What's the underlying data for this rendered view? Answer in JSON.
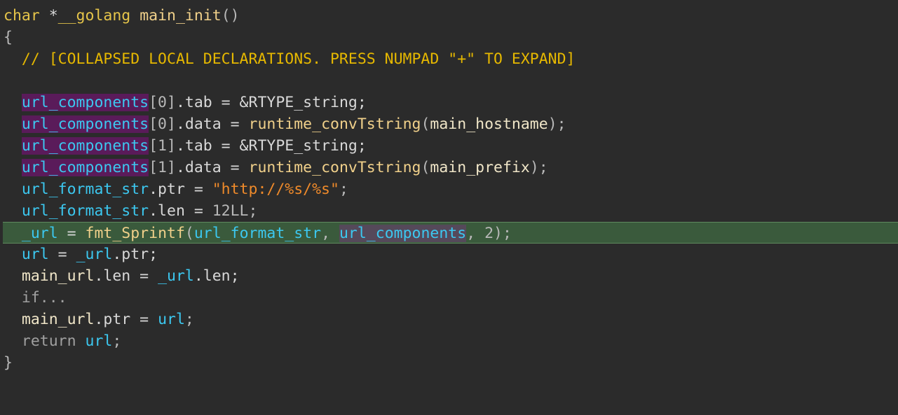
{
  "editor": {
    "lines": [
      {
        "id": "l0",
        "parts": [
          {
            "t": "char",
            "c": "tok-kw"
          },
          {
            "t": " *",
            "c": "tok-txt"
          },
          {
            "t": "__golang",
            "c": "tok-kw"
          },
          {
            "t": " ",
            "c": "tok-txt"
          },
          {
            "t": "main_init",
            "c": "tok-fn"
          },
          {
            "t": "()",
            "c": "tok-pun"
          }
        ]
      },
      {
        "id": "l1",
        "parts": [
          {
            "t": "{",
            "c": "tok-pun"
          }
        ]
      },
      {
        "id": "l2",
        "parts": [
          {
            "t": "  // [COLLAPSED LOCAL DECLARATIONS. PRESS NUMPAD \"+\" TO EXPAND]",
            "c": "tok-cm"
          }
        ]
      },
      {
        "id": "l3",
        "parts": []
      },
      {
        "id": "l4",
        "parts": [
          {
            "t": "  ",
            "c": "tok-txt"
          },
          {
            "t": "url_components",
            "c": "tok-var",
            "sel": "sel-purple"
          },
          {
            "t": "[0]",
            "c": "tok-pun"
          },
          {
            "t": ".tab = &RTYPE_string;",
            "c": "tok-txt"
          }
        ]
      },
      {
        "id": "l5",
        "parts": [
          {
            "t": "  ",
            "c": "tok-txt"
          },
          {
            "t": "url_components",
            "c": "tok-var",
            "sel": "sel-purple"
          },
          {
            "t": "[0]",
            "c": "tok-pun"
          },
          {
            "t": ".data = ",
            "c": "tok-txt"
          },
          {
            "t": "runtime_convTstring",
            "c": "tok-func"
          },
          {
            "t": "(",
            "c": "tok-pun"
          },
          {
            "t": "main_hostname",
            "c": "tok-gv"
          },
          {
            "t": ");",
            "c": "tok-pun"
          }
        ]
      },
      {
        "id": "l6",
        "parts": [
          {
            "t": "  ",
            "c": "tok-txt"
          },
          {
            "t": "url_components",
            "c": "tok-var",
            "sel": "sel-purple"
          },
          {
            "t": "[1]",
            "c": "tok-pun"
          },
          {
            "t": ".tab = &RTYPE_string;",
            "c": "tok-txt"
          }
        ]
      },
      {
        "id": "l7",
        "parts": [
          {
            "t": "  ",
            "c": "tok-txt"
          },
          {
            "t": "url_components",
            "c": "tok-var",
            "sel": "sel-purple"
          },
          {
            "t": "[1]",
            "c": "tok-pun"
          },
          {
            "t": ".data = ",
            "c": "tok-txt"
          },
          {
            "t": "runtime_convTstring",
            "c": "tok-func"
          },
          {
            "t": "(",
            "c": "tok-pun"
          },
          {
            "t": "main_prefix",
            "c": "tok-gv"
          },
          {
            "t": ");",
            "c": "tok-pun"
          }
        ]
      },
      {
        "id": "l8",
        "parts": [
          {
            "t": "  ",
            "c": "tok-txt"
          },
          {
            "t": "url_format_str",
            "c": "tok-var"
          },
          {
            "t": ".ptr = ",
            "c": "tok-txt"
          },
          {
            "t": "\"http://%s/%s\"",
            "c": "tok-str"
          },
          {
            "t": ";",
            "c": "tok-pun"
          }
        ]
      },
      {
        "id": "l9",
        "parts": [
          {
            "t": "  ",
            "c": "tok-txt"
          },
          {
            "t": "url_format_str",
            "c": "tok-var"
          },
          {
            "t": ".len = ",
            "c": "tok-txt"
          },
          {
            "t": "12LL",
            "c": "tok-num"
          },
          {
            "t": ";",
            "c": "tok-pun"
          }
        ]
      },
      {
        "id": "l10",
        "hl": true,
        "parts": [
          {
            "t": "  ",
            "c": "tok-txt"
          },
          {
            "t": "_url",
            "c": "tok-var"
          },
          {
            "t": " = ",
            "c": "tok-txt"
          },
          {
            "t": "fmt_Sprintf",
            "c": "tok-func"
          },
          {
            "t": "(",
            "c": "tok-pun"
          },
          {
            "t": "url_format_str",
            "c": "tok-var"
          },
          {
            "t": ", ",
            "c": "tok-pun"
          },
          {
            "t": "url_components",
            "c": "tok-var",
            "sel": "sel-grey"
          },
          {
            "t": ", ",
            "c": "tok-pun"
          },
          {
            "t": "2",
            "c": "tok-num"
          },
          {
            "t": ");",
            "c": "tok-pun"
          }
        ]
      },
      {
        "id": "l11",
        "parts": [
          {
            "t": "  ",
            "c": "tok-txt"
          },
          {
            "t": "url",
            "c": "tok-var"
          },
          {
            "t": " = ",
            "c": "tok-txt"
          },
          {
            "t": "_url",
            "c": "tok-var"
          },
          {
            "t": ".ptr;",
            "c": "tok-txt"
          }
        ]
      },
      {
        "id": "l12",
        "parts": [
          {
            "t": "  ",
            "c": "tok-txt"
          },
          {
            "t": "main_url",
            "c": "tok-gv"
          },
          {
            "t": ".len = ",
            "c": "tok-txt"
          },
          {
            "t": "_url",
            "c": "tok-var"
          },
          {
            "t": ".len;",
            "c": "tok-txt"
          }
        ]
      },
      {
        "id": "l13",
        "parts": [
          {
            "t": "  if...",
            "c": "tok-ctl"
          }
        ]
      },
      {
        "id": "l14",
        "parts": [
          {
            "t": "  ",
            "c": "tok-txt"
          },
          {
            "t": "main_url",
            "c": "tok-gv"
          },
          {
            "t": ".ptr = ",
            "c": "tok-txt"
          },
          {
            "t": "url",
            "c": "tok-var"
          },
          {
            "t": ";",
            "c": "tok-pun"
          }
        ]
      },
      {
        "id": "l15",
        "parts": [
          {
            "t": "  return ",
            "c": "tok-ctl"
          },
          {
            "t": "url",
            "c": "tok-var"
          },
          {
            "t": ";",
            "c": "tok-pun"
          }
        ]
      },
      {
        "id": "l16",
        "parts": [
          {
            "t": "}",
            "c": "tok-pun"
          }
        ]
      }
    ]
  }
}
